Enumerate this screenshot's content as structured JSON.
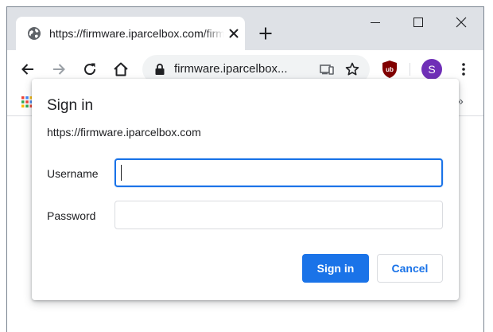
{
  "tab": {
    "title": "https://firmware.iparcelbox.com/firmware",
    "favicon": "globe-icon"
  },
  "window_controls": [
    "minimize-icon",
    "maximize-icon",
    "close-icon"
  ],
  "toolbar": {
    "back": "back-arrow-icon",
    "forward": "forward-arrow-icon",
    "reload": "reload-icon",
    "home": "home-icon",
    "address": "firmware.iparcelbox...",
    "lock": "lock-icon",
    "cast": "cast-icon",
    "star": "star-icon",
    "extension": "ublock-origin-icon",
    "profile_initial": "S",
    "menu": "kebab-menu-icon"
  },
  "bookmarks": {
    "apps": "apps-grid-icon",
    "more_glyph": "»"
  },
  "dialog": {
    "title": "Sign in",
    "origin": "https://firmware.iparcelbox.com",
    "username_label": "Username",
    "username_value": "",
    "password_label": "Password",
    "password_value": "",
    "signin_label": "Sign in",
    "cancel_label": "Cancel"
  },
  "colors": {
    "accent": "#1a73e8",
    "avatar": "#6f2fb7",
    "ublock": "#800000",
    "tabstrip": "#dee1e6",
    "omnibox": "#f1f3f4"
  }
}
